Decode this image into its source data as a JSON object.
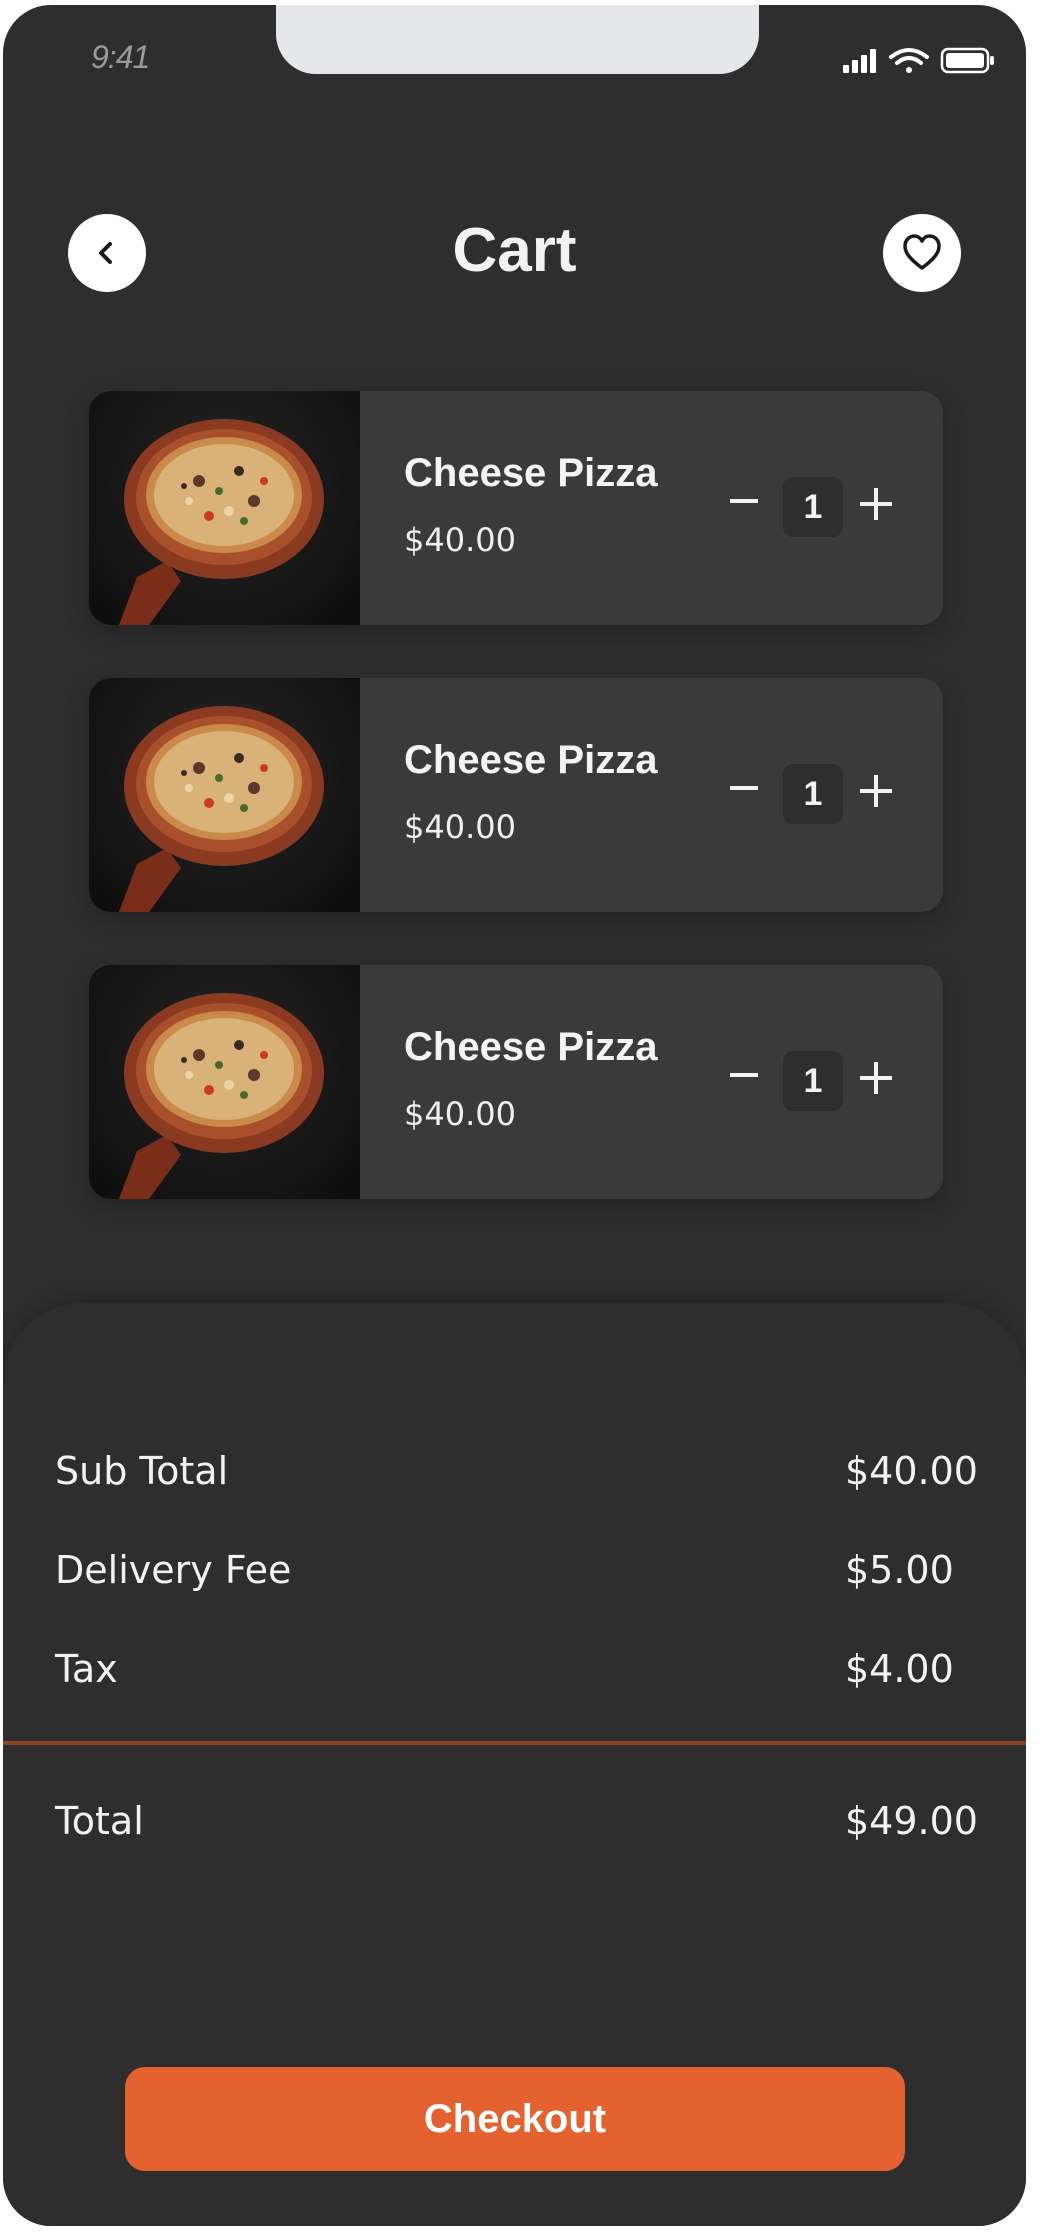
{
  "status_bar": {
    "time": "9:41",
    "icons": [
      "cellular-signal-icon",
      "wifi-icon",
      "battery-icon"
    ]
  },
  "header": {
    "title": "Cart",
    "back_icon": "chevron-left-icon",
    "favorite_icon": "heart-icon"
  },
  "cart": {
    "items": [
      {
        "name": "Cheese Pizza",
        "price": "$40.00",
        "quantity": "1",
        "image": "pizza-photo"
      },
      {
        "name": "Cheese Pizza",
        "price": "$40.00",
        "quantity": "1",
        "image": "pizza-photo"
      },
      {
        "name": "Cheese Pizza",
        "price": "$40.00",
        "quantity": "1",
        "image": "pizza-photo"
      }
    ]
  },
  "summary": {
    "subtotal_label": "Sub Total",
    "subtotal_value": "$40.00",
    "delivery_label": "Delivery Fee",
    "delivery_value": "$5.00",
    "tax_label": "Tax",
    "tax_value": "$4.00",
    "total_label": "Total",
    "total_value": "$49.00"
  },
  "checkout": {
    "label": "Checkout"
  },
  "colors": {
    "background": "#2e2e2e",
    "card": "#3a3a3a",
    "accent": "#e3622f",
    "divider": "#8c4426",
    "text": "#f2f2f2"
  }
}
